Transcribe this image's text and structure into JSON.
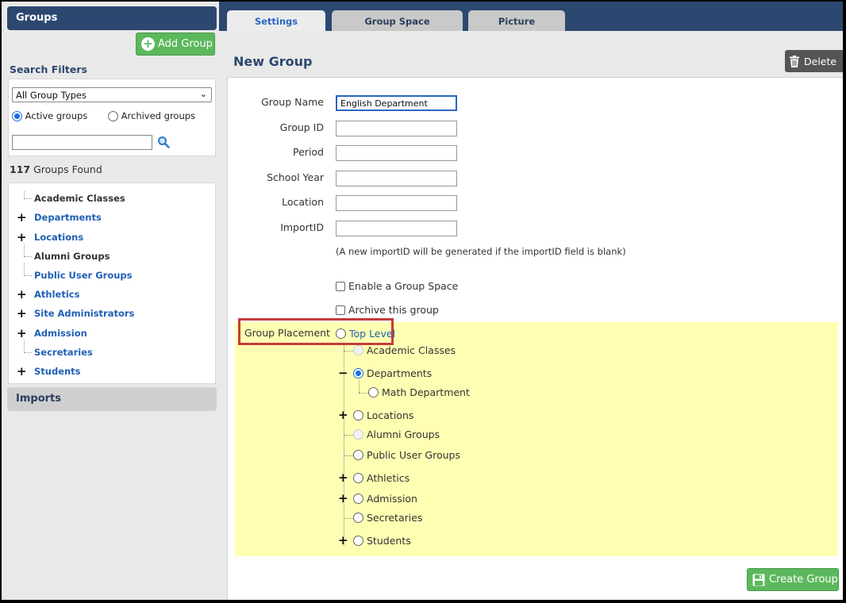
{
  "sidebar": {
    "groups_title": "Groups",
    "add_group_label": "Add Group",
    "search_filters_label": "Search Filters",
    "group_type_selected": "All Group Types",
    "active_label": "Active groups",
    "archived_label": "Archived groups",
    "found_count": "117",
    "found_text": "Groups Found",
    "tree": [
      {
        "label": "Academic Classes",
        "expandable": false,
        "link": false
      },
      {
        "label": "Departments",
        "expandable": true,
        "link": true
      },
      {
        "label": "Locations",
        "expandable": true,
        "link": true
      },
      {
        "label": "Alumni Groups",
        "expandable": false,
        "link": false
      },
      {
        "label": "Public User Groups",
        "expandable": false,
        "link": true
      },
      {
        "label": "Athletics",
        "expandable": true,
        "link": true
      },
      {
        "label": "Site Administrators",
        "expandable": true,
        "link": true
      },
      {
        "label": "Admission",
        "expandable": true,
        "link": true
      },
      {
        "label": "Secretaries",
        "expandable": false,
        "link": true
      },
      {
        "label": "Students",
        "expandable": true,
        "link": true
      }
    ],
    "imports_title": "Imports"
  },
  "tabs": [
    "Settings",
    "Group Space",
    "Picture"
  ],
  "main": {
    "title": "New Group",
    "delete_label": "Delete",
    "fields": [
      {
        "label": "Group Name",
        "value": "English Department"
      },
      {
        "label": "Group ID",
        "value": ""
      },
      {
        "label": "Period",
        "value": ""
      },
      {
        "label": "School Year",
        "value": ""
      },
      {
        "label": "Location",
        "value": ""
      },
      {
        "label": "ImportID",
        "value": ""
      }
    ],
    "importid_note": "(A new importID will be generated if the importID field is blank)",
    "enable_space_label": "Enable a Group Space",
    "archive_label": "Archive this group",
    "placement_label": "Group Placement",
    "placement_tree": {
      "top_level": "Top Level",
      "items": [
        {
          "label": "Academic Classes",
          "state": "disabled",
          "expander": ""
        },
        {
          "label": "Departments",
          "state": "checked",
          "expander": "−"
        },
        {
          "label": "Math Department",
          "state": "normal",
          "expander": ""
        },
        {
          "label": "Locations",
          "state": "normal",
          "expander": "+"
        },
        {
          "label": "Alumni Groups",
          "state": "disabled",
          "expander": ""
        },
        {
          "label": "Public User Groups",
          "state": "normal",
          "expander": ""
        },
        {
          "label": "Athletics",
          "state": "normal",
          "expander": "+"
        },
        {
          "label": "Admission",
          "state": "normal",
          "expander": "+"
        },
        {
          "label": "Secretaries",
          "state": "normal",
          "expander": ""
        },
        {
          "label": "Students",
          "state": "normal",
          "expander": "+"
        }
      ]
    },
    "create_label": "Create Group"
  },
  "colors": {
    "header_navy": "#2c4870",
    "link_blue": "#1f5fb5",
    "button_green": "#5cb85c",
    "placement_yellow": "#ffffb3",
    "highlight_red": "#c63b3b"
  }
}
